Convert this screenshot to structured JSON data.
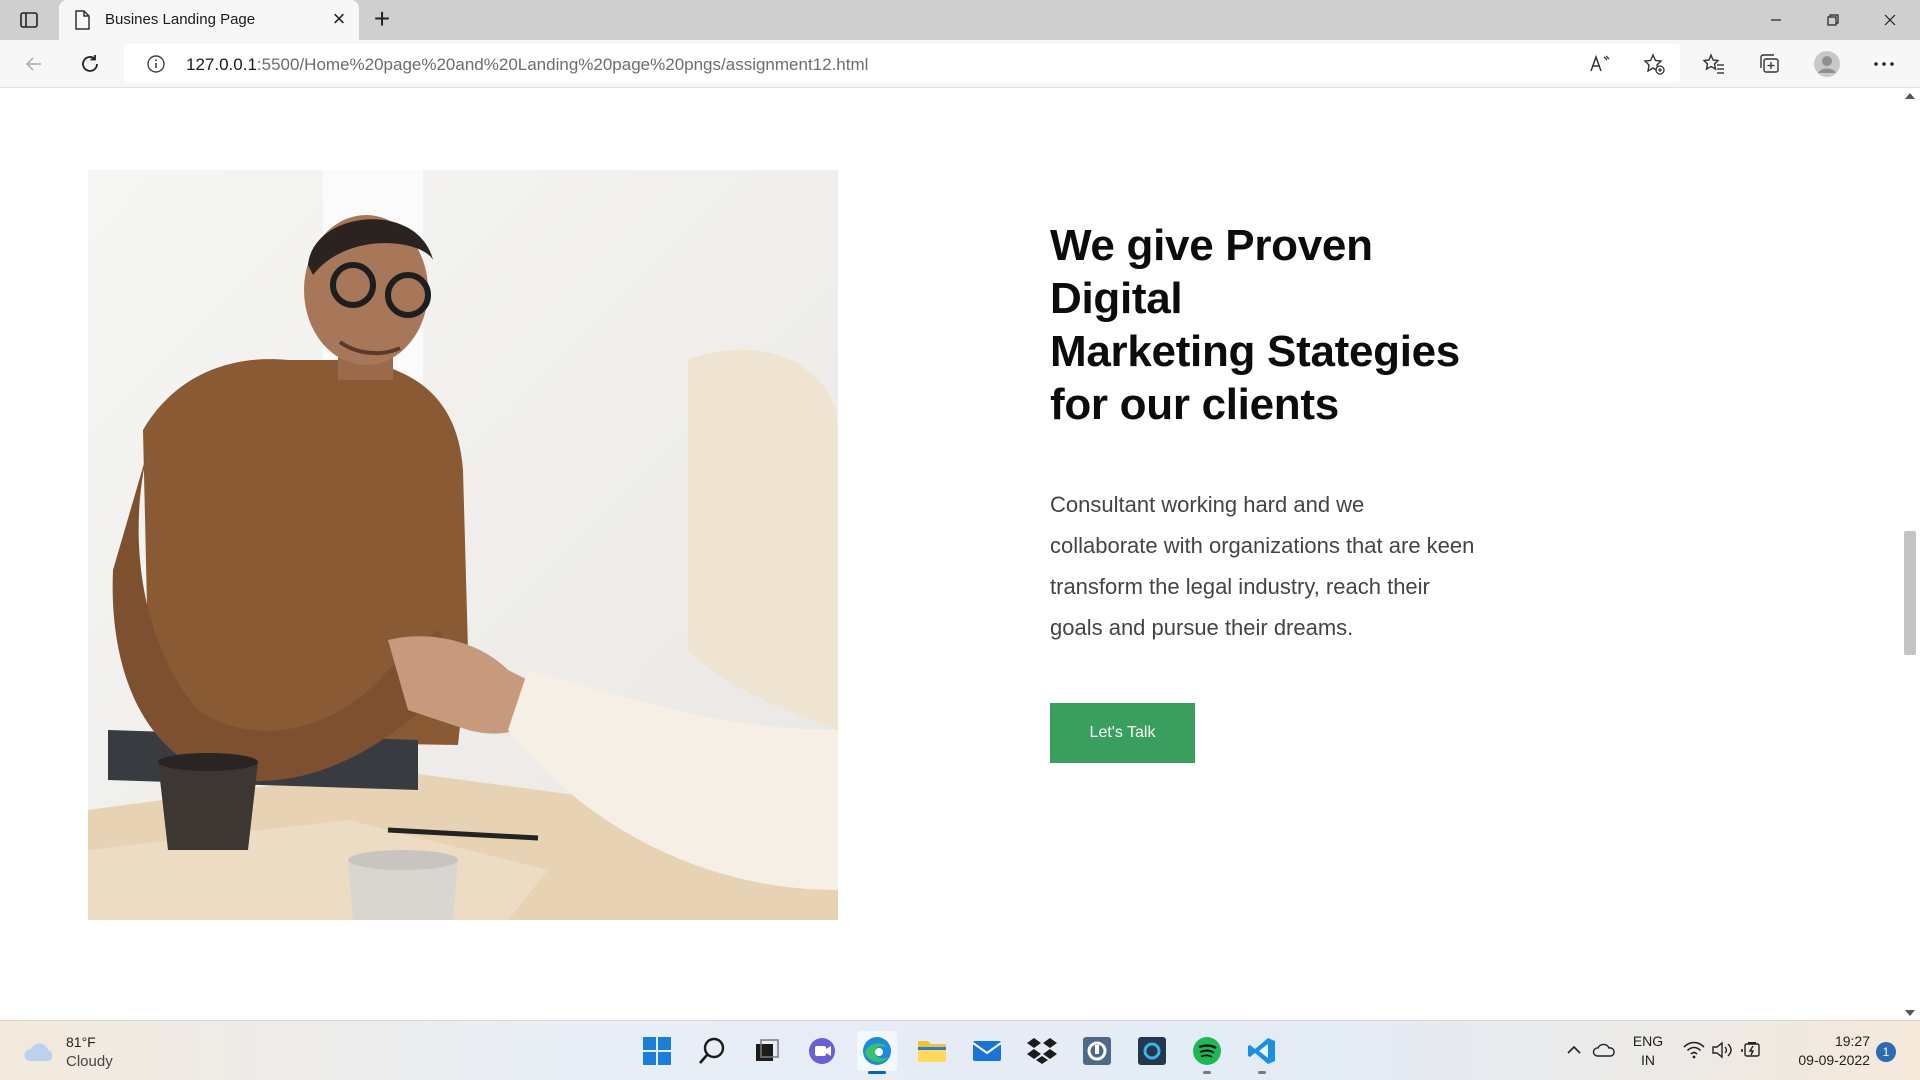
{
  "browser": {
    "tab_title": "Busines Landing Page",
    "url_host": "127.0.0.1",
    "url_rest": ":5500/Home%20page%20and%20Landing%20page%20pngs/assignment12.html"
  },
  "page": {
    "heading_line1": "We give Proven Digital",
    "heading_line2": "Marketing Stategies",
    "heading_line3": "for our clients",
    "body_line1": "Consultant working hard and we",
    "body_line2": "collaborate with organizations that are keen",
    "body_line3": "transform the legal industry, reach their",
    "body_line4": "goals and pursue their dreams.",
    "cta_label": "Let's Talk",
    "accent_color": "#3a9e5f"
  },
  "taskbar": {
    "weather_temp": "81°F",
    "weather_condition": "Cloudy",
    "language_line1": "ENG",
    "language_line2": "IN",
    "time": "19:27",
    "date": "09-09-2022",
    "notification_count": "1",
    "apps": [
      "start",
      "search",
      "task-view",
      "teams-chat",
      "edge",
      "file-explorer",
      "mail",
      "dropbox",
      "app-tile",
      "cortana",
      "spotify",
      "vscode"
    ]
  }
}
